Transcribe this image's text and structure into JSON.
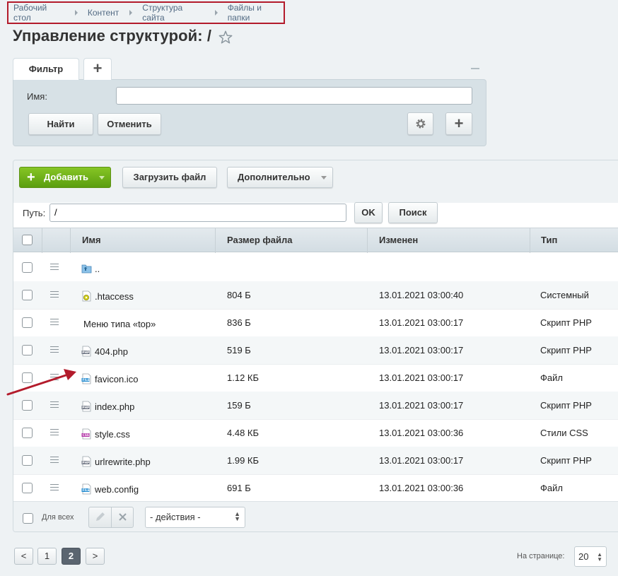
{
  "breadcrumb": [
    "Рабочий стол",
    "Контент",
    "Структура сайта",
    "Файлы и папки"
  ],
  "page_title": "Управление структурой: /",
  "filter": {
    "tab_label": "Фильтр",
    "name_label": "Имя:",
    "name_value": "",
    "find_label": "Найти",
    "cancel_label": "Отменить"
  },
  "toolbar": {
    "add_label": "Добавить",
    "upload_label": "Загрузить файл",
    "more_label": "Дополнительно",
    "path_label": "Путь:",
    "path_value": "/",
    "ok_label": "OK",
    "search_label": "Поиск"
  },
  "grid": {
    "columns": [
      "Имя",
      "Размер файла",
      "Изменен",
      "Тип"
    ],
    "rows": [
      {
        "icon": "folder-up-icon",
        "name": "..",
        "size": "",
        "date": "",
        "type": ""
      },
      {
        "icon": "htaccess-icon",
        "name": ".htaccess",
        "size": "804 Б",
        "date": "13.01.2021 03:00:40",
        "type": "Системный"
      },
      {
        "icon": "none",
        "name": "Меню типа «top»",
        "size": "836 Б",
        "date": "13.01.2021 03:00:17",
        "type": "Скрипт PHP"
      },
      {
        "icon": "php-file-icon",
        "name": "404.php",
        "size": "519 Б",
        "date": "13.01.2021 03:00:17",
        "type": "Скрипт PHP"
      },
      {
        "icon": "file-icon",
        "name": "favicon.ico",
        "size": "1.12 КБ",
        "date": "13.01.2021 03:00:17",
        "type": "Файл"
      },
      {
        "icon": "php-file-icon",
        "name": "index.php",
        "size": "159 Б",
        "date": "13.01.2021 03:00:17",
        "type": "Скрипт PHP"
      },
      {
        "icon": "css-file-icon",
        "name": "style.css",
        "size": "4.48 КБ",
        "date": "13.01.2021 03:00:36",
        "type": "Стили CSS"
      },
      {
        "icon": "php-file-icon",
        "name": "urlrewrite.php",
        "size": "1.99 КБ",
        "date": "13.01.2021 03:00:17",
        "type": "Скрипт PHP"
      },
      {
        "icon": "file-icon",
        "name": "web.config",
        "size": "691 Б",
        "date": "13.01.2021 03:00:36",
        "type": "Файл"
      }
    ]
  },
  "footer": {
    "for_all_label": "Для всех",
    "actions_value": "- действия -"
  },
  "pagination": {
    "prev": "<",
    "pages": [
      "1",
      "2"
    ],
    "current": "2",
    "next": ">",
    "per_page_label": "На странице:",
    "per_page_value": "20"
  },
  "colors": {
    "breadcrumb_highlight": "#b31b2b",
    "add_button": "#6aaf17",
    "annotation_arrow": "#b31b2b"
  }
}
